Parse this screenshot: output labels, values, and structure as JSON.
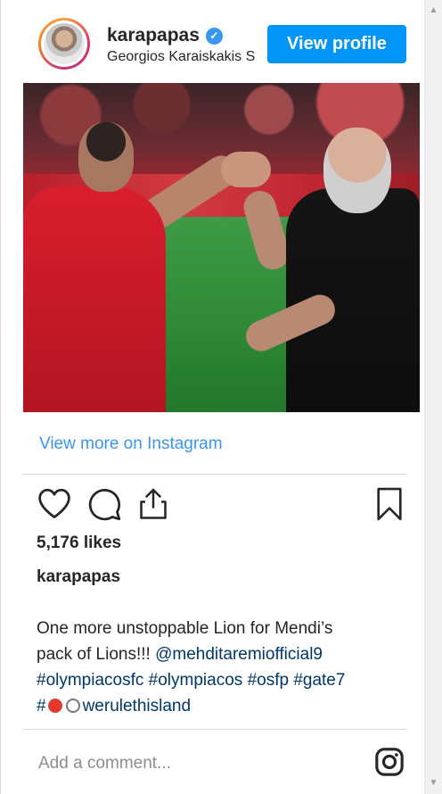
{
  "header": {
    "username": "karapapas",
    "location": "Georgios Karaiskakis S",
    "view_profile_label": "View profile",
    "verified_mark": "✓"
  },
  "post": {
    "view_more_label": "View more on Instagram",
    "likes_text": "5,176 likes",
    "caption_username": "karapapas",
    "caption": {
      "line1": "One more unstoppable Lion for Mendi’s",
      "line2_text": "pack of Lions!!! ",
      "line2_mention": "@mehditaremiofficial9",
      "line3_hashtags": [
        "#olympiacosfc",
        "#olympiacos",
        "#osfp",
        "#gate7"
      ],
      "line4_hash": "#",
      "line4_tail": "werulethisland"
    },
    "comment_placeholder": "Add a comment..."
  },
  "icons": {
    "like": "heart-icon",
    "comment": "comment-icon",
    "share": "share-icon",
    "save": "bookmark-icon",
    "instagram": "instagram-icon",
    "scroll_up": "▲",
    "scroll_down": "▼"
  },
  "colors": {
    "link_blue": "#3897f0",
    "button_blue": "#0095f6",
    "text": "#262626",
    "muted": "#8e8e8e"
  }
}
